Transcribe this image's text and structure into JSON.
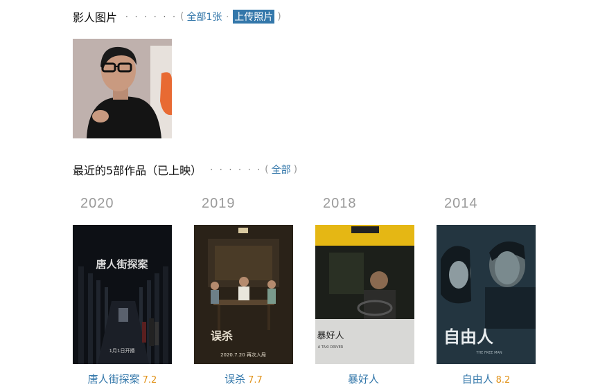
{
  "photos_section": {
    "title": "影人图片",
    "dots": "· · · · · ·",
    "open_paren": "(",
    "all_link": "全部1张",
    "separator": "·",
    "upload_link": "上传照片",
    "close_paren": ")"
  },
  "works_section": {
    "title": "最近的5部作品（已上映）",
    "dots": "· · · · · ·",
    "open_paren": "(",
    "all_link": "全部",
    "close_paren": ")"
  },
  "works": [
    {
      "year": "2020",
      "title": "唐人街探案",
      "rating": "7.2",
      "poster_text": "唐人街探案",
      "poster_subtext": "1月1日开播"
    },
    {
      "year": "2019",
      "title": "误杀",
      "rating": "7.7",
      "poster_text": "误杀",
      "poster_subtext": "2020.7.20 再次入局"
    },
    {
      "year": "2018",
      "title": "暴好人",
      "rating": "",
      "poster_text": "暴好人",
      "poster_subtext": "A TAXI DRIVER"
    },
    {
      "year": "2014",
      "title": "自由人",
      "rating": "8.2",
      "poster_text": "自由人",
      "poster_subtext": "THE FREE MAN"
    }
  ],
  "colors": {
    "link": "#3377aa",
    "rating": "#e09015",
    "year": "#9a9a9a"
  }
}
